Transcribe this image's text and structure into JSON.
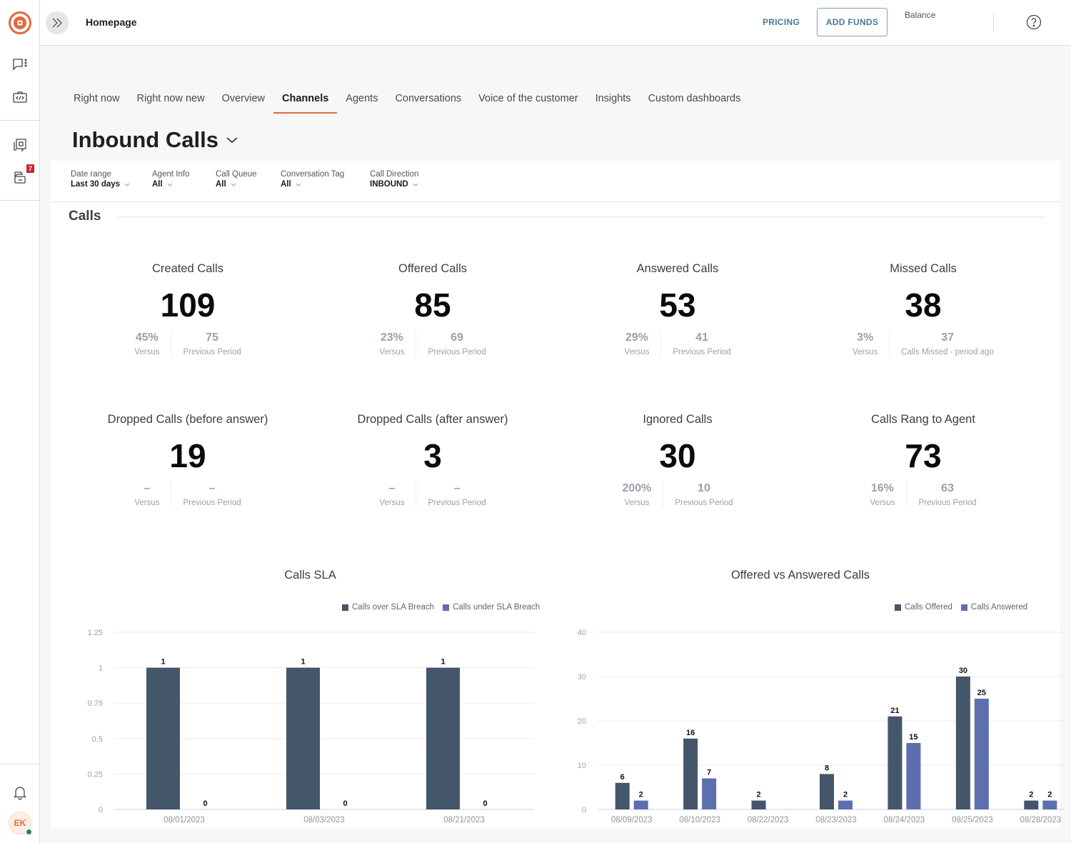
{
  "colors": {
    "accent": "#e2693b",
    "link": "#4a7899",
    "series_dark": "#44566a",
    "series_blue": "#5e6fb0",
    "muted_text": "#98a1ad",
    "badge": "#c8262f"
  },
  "sidebar": {
    "logo": "brand-logo-icon",
    "items": [
      {
        "icon": "chat-menu-icon"
      },
      {
        "icon": "code-briefcase-icon"
      },
      {
        "icon": "conversations-icon"
      },
      {
        "icon": "inbox-icon",
        "badge": "7"
      }
    ],
    "bottom": {
      "notification_icon": "bell-icon",
      "avatar_initials": "EK",
      "presence": "online"
    }
  },
  "topbar": {
    "breadcrumb": "Homepage",
    "pricing_label": "PRICING",
    "add_funds_label": "ADD FUNDS",
    "balance_label": "Balance",
    "help_icon": "help-circle-icon"
  },
  "tabs": [
    {
      "label": "Right now",
      "active": false
    },
    {
      "label": "Right now new",
      "active": false
    },
    {
      "label": "Overview",
      "active": false
    },
    {
      "label": "Channels",
      "active": true
    },
    {
      "label": "Agents",
      "active": false
    },
    {
      "label": "Conversations",
      "active": false
    },
    {
      "label": "Voice of the customer",
      "active": false
    },
    {
      "label": "Insights",
      "active": false
    },
    {
      "label": "Custom dashboards",
      "active": false
    }
  ],
  "page_title": "Inbound Calls",
  "filters": [
    {
      "label": "Date range",
      "value": "Last 30 days"
    },
    {
      "label": "Agent Info",
      "value": "All"
    },
    {
      "label": "Call Queue",
      "value": "All"
    },
    {
      "label": "Conversation Tag",
      "value": "All"
    },
    {
      "label": "Call Direction",
      "value": "INBOUND"
    }
  ],
  "section_title": "Calls",
  "kpis": [
    {
      "title": "Created Calls",
      "value": "109",
      "versus": "45%",
      "versus_label": "Versus",
      "previous": "75",
      "previous_label": "Previous Period"
    },
    {
      "title": "Offered Calls",
      "value": "85",
      "versus": "23%",
      "versus_label": "Versus",
      "previous": "69",
      "previous_label": "Previous Period"
    },
    {
      "title": "Answered Calls",
      "value": "53",
      "versus": "29%",
      "versus_label": "Versus",
      "previous": "41",
      "previous_label": "Previous Period"
    },
    {
      "title": "Missed Calls",
      "value": "38",
      "versus": "3%",
      "versus_label": "Versus",
      "previous": "37",
      "previous_label": "Calls Missed - period ago"
    },
    {
      "title": "Dropped Calls (before answer)",
      "value": "19",
      "versus": "–",
      "versus_label": "Versus",
      "previous": "–",
      "previous_label": "Previous Period"
    },
    {
      "title": "Dropped Calls (after answer)",
      "value": "3",
      "versus": "–",
      "versus_label": "Versus",
      "previous": "–",
      "previous_label": "Previous Period"
    },
    {
      "title": "Ignored Calls",
      "value": "30",
      "versus": "200%",
      "versus_label": "Versus",
      "previous": "10",
      "previous_label": "Previous Period"
    },
    {
      "title": "Calls Rang to Agent",
      "value": "73",
      "versus": "16%",
      "versus_label": "Versus",
      "previous": "63",
      "previous_label": "Previous Period"
    }
  ],
  "chart_data": [
    {
      "type": "bar",
      "title": "Calls SLA",
      "categories": [
        "08/01/2023",
        "08/03/2023",
        "08/21/2023"
      ],
      "series": [
        {
          "name": "Calls over SLA Breach",
          "values": [
            1,
            1,
            1
          ],
          "color": "#44566a"
        },
        {
          "name": "Calls under SLA Breach",
          "values": [
            0,
            0,
            0
          ],
          "color": "#5e6fb0"
        }
      ],
      "yticks": [
        "0",
        "0.25",
        "0.5",
        "0.75",
        "1",
        "1.25"
      ],
      "ylim": [
        0,
        1.25
      ],
      "xlabel": "",
      "ylabel": "",
      "grid": true,
      "legend": "top-right",
      "data_labels": true
    },
    {
      "type": "bar",
      "title": "Offered vs Answered Calls",
      "categories": [
        "08/09/2023",
        "08/10/2023",
        "08/22/2023",
        "08/23/2023",
        "08/24/2023",
        "08/25/2023",
        "08/28/2023"
      ],
      "series": [
        {
          "name": "Calls Offered",
          "values": [
            6,
            16,
            2,
            8,
            21,
            30,
            2
          ],
          "color": "#44566a"
        },
        {
          "name": "Calls Answered",
          "values": [
            2,
            7,
            null,
            2,
            15,
            25,
            2
          ],
          "color": "#5e6fb0"
        }
      ],
      "yticks": [
        "0",
        "10",
        "20",
        "30",
        "40"
      ],
      "ylim": [
        0,
        40
      ],
      "xlabel": "",
      "ylabel": "",
      "grid": true,
      "legend": "top-right",
      "data_labels": true
    }
  ]
}
